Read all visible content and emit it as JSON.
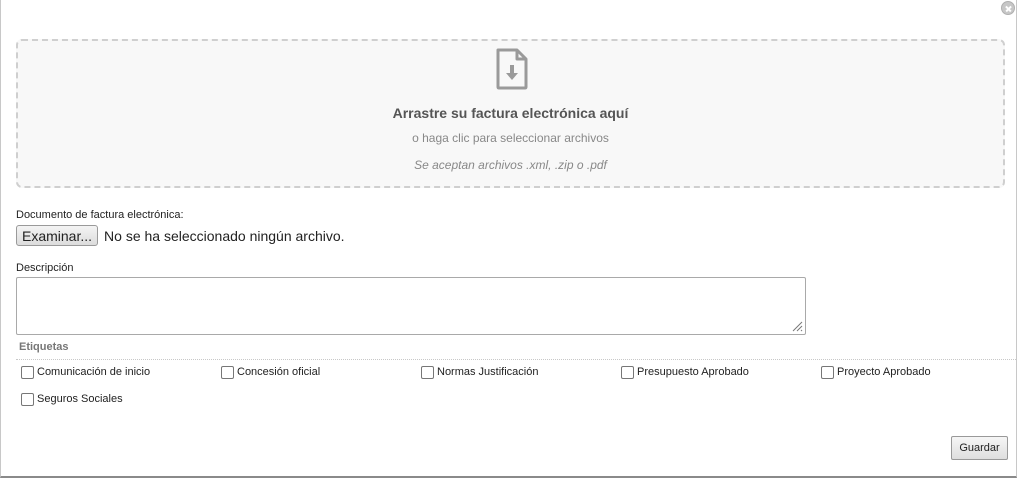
{
  "dropzone": {
    "title": "Arrastre su factura electrónica aquí",
    "subtitle": "o haga clic para seleccionar archivos",
    "accepted": "Se aceptan archivos .xml, .zip o .pdf",
    "icon": "file-download-icon"
  },
  "file_input": {
    "label": "Documento de factura electrónica:",
    "button_label": "Examinar...",
    "status": "No se ha seleccionado ningún archivo."
  },
  "description": {
    "label": "Descripción",
    "value": ""
  },
  "tags": {
    "legend": "Etiquetas",
    "items": [
      {
        "label": "Comunicación de inicio",
        "checked": false
      },
      {
        "label": "Concesión oficial",
        "checked": false
      },
      {
        "label": "Normas Justificación",
        "checked": false
      },
      {
        "label": "Presupuesto Aprobado",
        "checked": false
      },
      {
        "label": "Proyecto Aprobado",
        "checked": false
      },
      {
        "label": "Seguros Sociales",
        "checked": false
      }
    ]
  },
  "actions": {
    "save_label": "Guardar"
  },
  "colors": {
    "dropzone_bg": "#f8f8f8",
    "dropzone_border": "#cfcfcf",
    "icon_gray": "#9a9a9a"
  }
}
